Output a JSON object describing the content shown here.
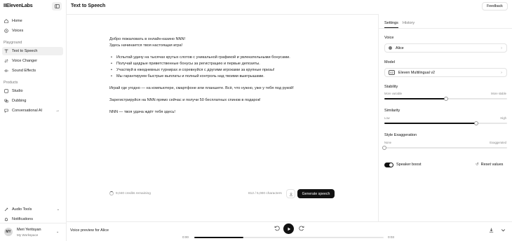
{
  "sidebar": {
    "logo": "IIElevenLabs",
    "top_items": [
      {
        "label": "Home",
        "icon": "home-icon"
      },
      {
        "label": "Voices",
        "icon": "voices-icon"
      }
    ],
    "playground_title": "Playground",
    "playground_items": [
      {
        "label": "Text to Speech",
        "icon": "text-to-speech-icon",
        "active": true
      },
      {
        "label": "Voice Changer",
        "icon": "voice-changer-icon"
      },
      {
        "label": "Sound Effects",
        "icon": "sound-effects-icon"
      }
    ],
    "products_title": "Products",
    "product_items": [
      {
        "label": "Studio",
        "icon": "studio-icon"
      },
      {
        "label": "Dubbing",
        "icon": "dubbing-icon"
      },
      {
        "label": "Conversational AI",
        "icon": "conversational-ai-icon"
      }
    ],
    "bottom_items": [
      {
        "label": "Audio Tools",
        "icon": "audio-tools-icon"
      },
      {
        "label": "Notifications",
        "icon": "bell-icon"
      }
    ],
    "user": {
      "initials": "MY",
      "name": "Meri Yeritsyan",
      "workspace": "My Workspace"
    }
  },
  "header": {
    "title": "Text to Speech",
    "feedback_label": "Feedback"
  },
  "editor": {
    "line1": "Добро пожаловать в онлайн-казино NNN!",
    "line2": "Здесь начинается твоя настоящая игра!",
    "bullets": [
      "Испытай удачу на тысячах крутых слотов с уникальной графикой и увлекательными бонусами.",
      "Получай щедрые приветственные бонусы за регистрацию и первые депозиты.",
      "Участвуй в ежедневных турнирах и соревнуйся с другими игроками за крупные призы!",
      "Мы гарантируем быстрые выплаты и полный контроль над твоими выигрышами."
    ],
    "para1": "Играй где угодно — на компьютере, смартфоне или планшете. Всё, что нужно, уже у тебя под рукой!",
    "para2": "Зарегистрируйся на NNN прямо сейчас и получи 50 бесплатных спинов в подарок!",
    "para3": "NNN — твоя удача ждёт тебя здесь!",
    "credits": "9,040 credits remaining",
    "char_count": "812 / 5,000 characters",
    "generate_label": "Generate speech"
  },
  "settings": {
    "tab_settings": "Settings",
    "tab_history": "History",
    "voice_label": "Voice",
    "voice_value": "Alice",
    "model_label": "Model",
    "model_badge": "V2",
    "model_value": "Eleven Multilingual v2",
    "stability": {
      "label": "Stability",
      "min": "More variable",
      "max": "More stable",
      "value": 0.5
    },
    "similarity": {
      "label": "Similarity",
      "min": "Low",
      "max": "High",
      "value": 0.75
    },
    "style": {
      "label": "Style Exaggeration",
      "min": "None",
      "max": "Exaggerated",
      "value": 0.0
    },
    "speaker_boost_label": "Speaker boost",
    "speaker_boost_on": true,
    "reset_label": "Reset values"
  },
  "player": {
    "preview_label": "Voice preview for Alice",
    "time_current": "0:00",
    "time_total": "0:03",
    "progress": 0.26
  }
}
